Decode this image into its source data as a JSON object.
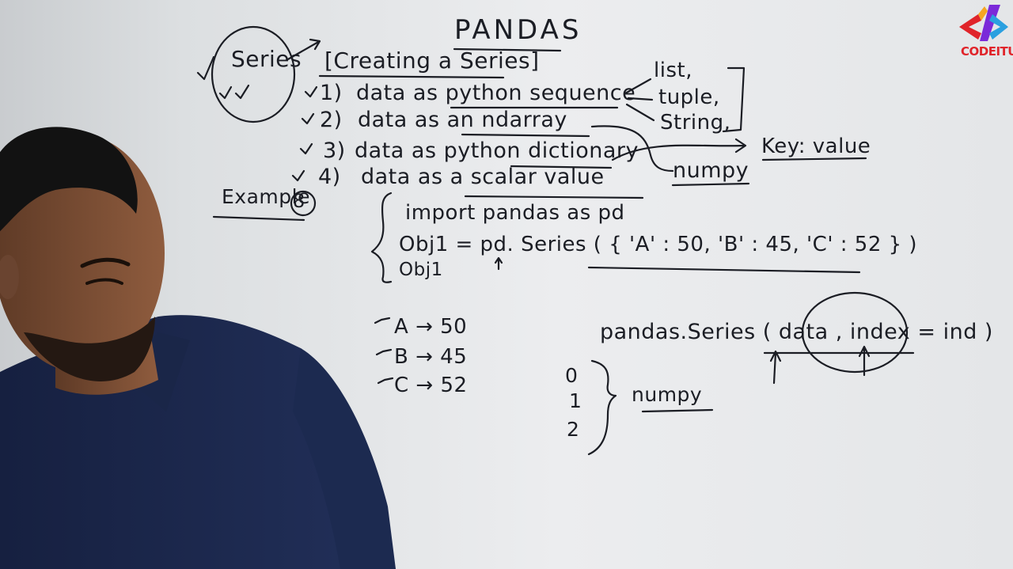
{
  "board": {
    "title": "PANDAS",
    "topic": "Series",
    "heading": "[Creating a Series]",
    "methods": [
      {
        "num": "1)",
        "text": "data as python sequence"
      },
      {
        "num": "2)",
        "text": "data as an ndarray"
      },
      {
        "num": "3)",
        "text": "data as python dictionary"
      },
      {
        "num": "4)",
        "text": "data as a scalar value"
      }
    ],
    "sequence_types": [
      "list,",
      "tuple,",
      "String,"
    ],
    "dict_note": "Key: value",
    "ndarray_note": "numpy",
    "example_label": "Example",
    "example_number": "8",
    "code": [
      "import pandas as pd",
      "Obj1 = pd. Series ( { 'A' : 50, 'B' : 45, 'C' : 52 } )",
      "Obj1"
    ],
    "output": [
      {
        "key": "A",
        "arrow": "→",
        "value": "50"
      },
      {
        "key": "B",
        "arrow": "→",
        "value": "45"
      },
      {
        "key": "C",
        "arrow": "→",
        "value": "52"
      }
    ],
    "signature": "pandas.Series ( data , index = ind )",
    "default_index": [
      "0",
      "1",
      "2"
    ],
    "default_index_note": "numpy"
  },
  "logo": {
    "text": "CODEITUP",
    "colors": [
      "#e0242a",
      "#f5a623",
      "#7b2ad9",
      "#2aa0e0"
    ]
  },
  "colors": {
    "board": "#e8e9eb",
    "ink": "#1b1d24",
    "shirt": "#1e2a4e",
    "skin": "#8a5a3e"
  }
}
